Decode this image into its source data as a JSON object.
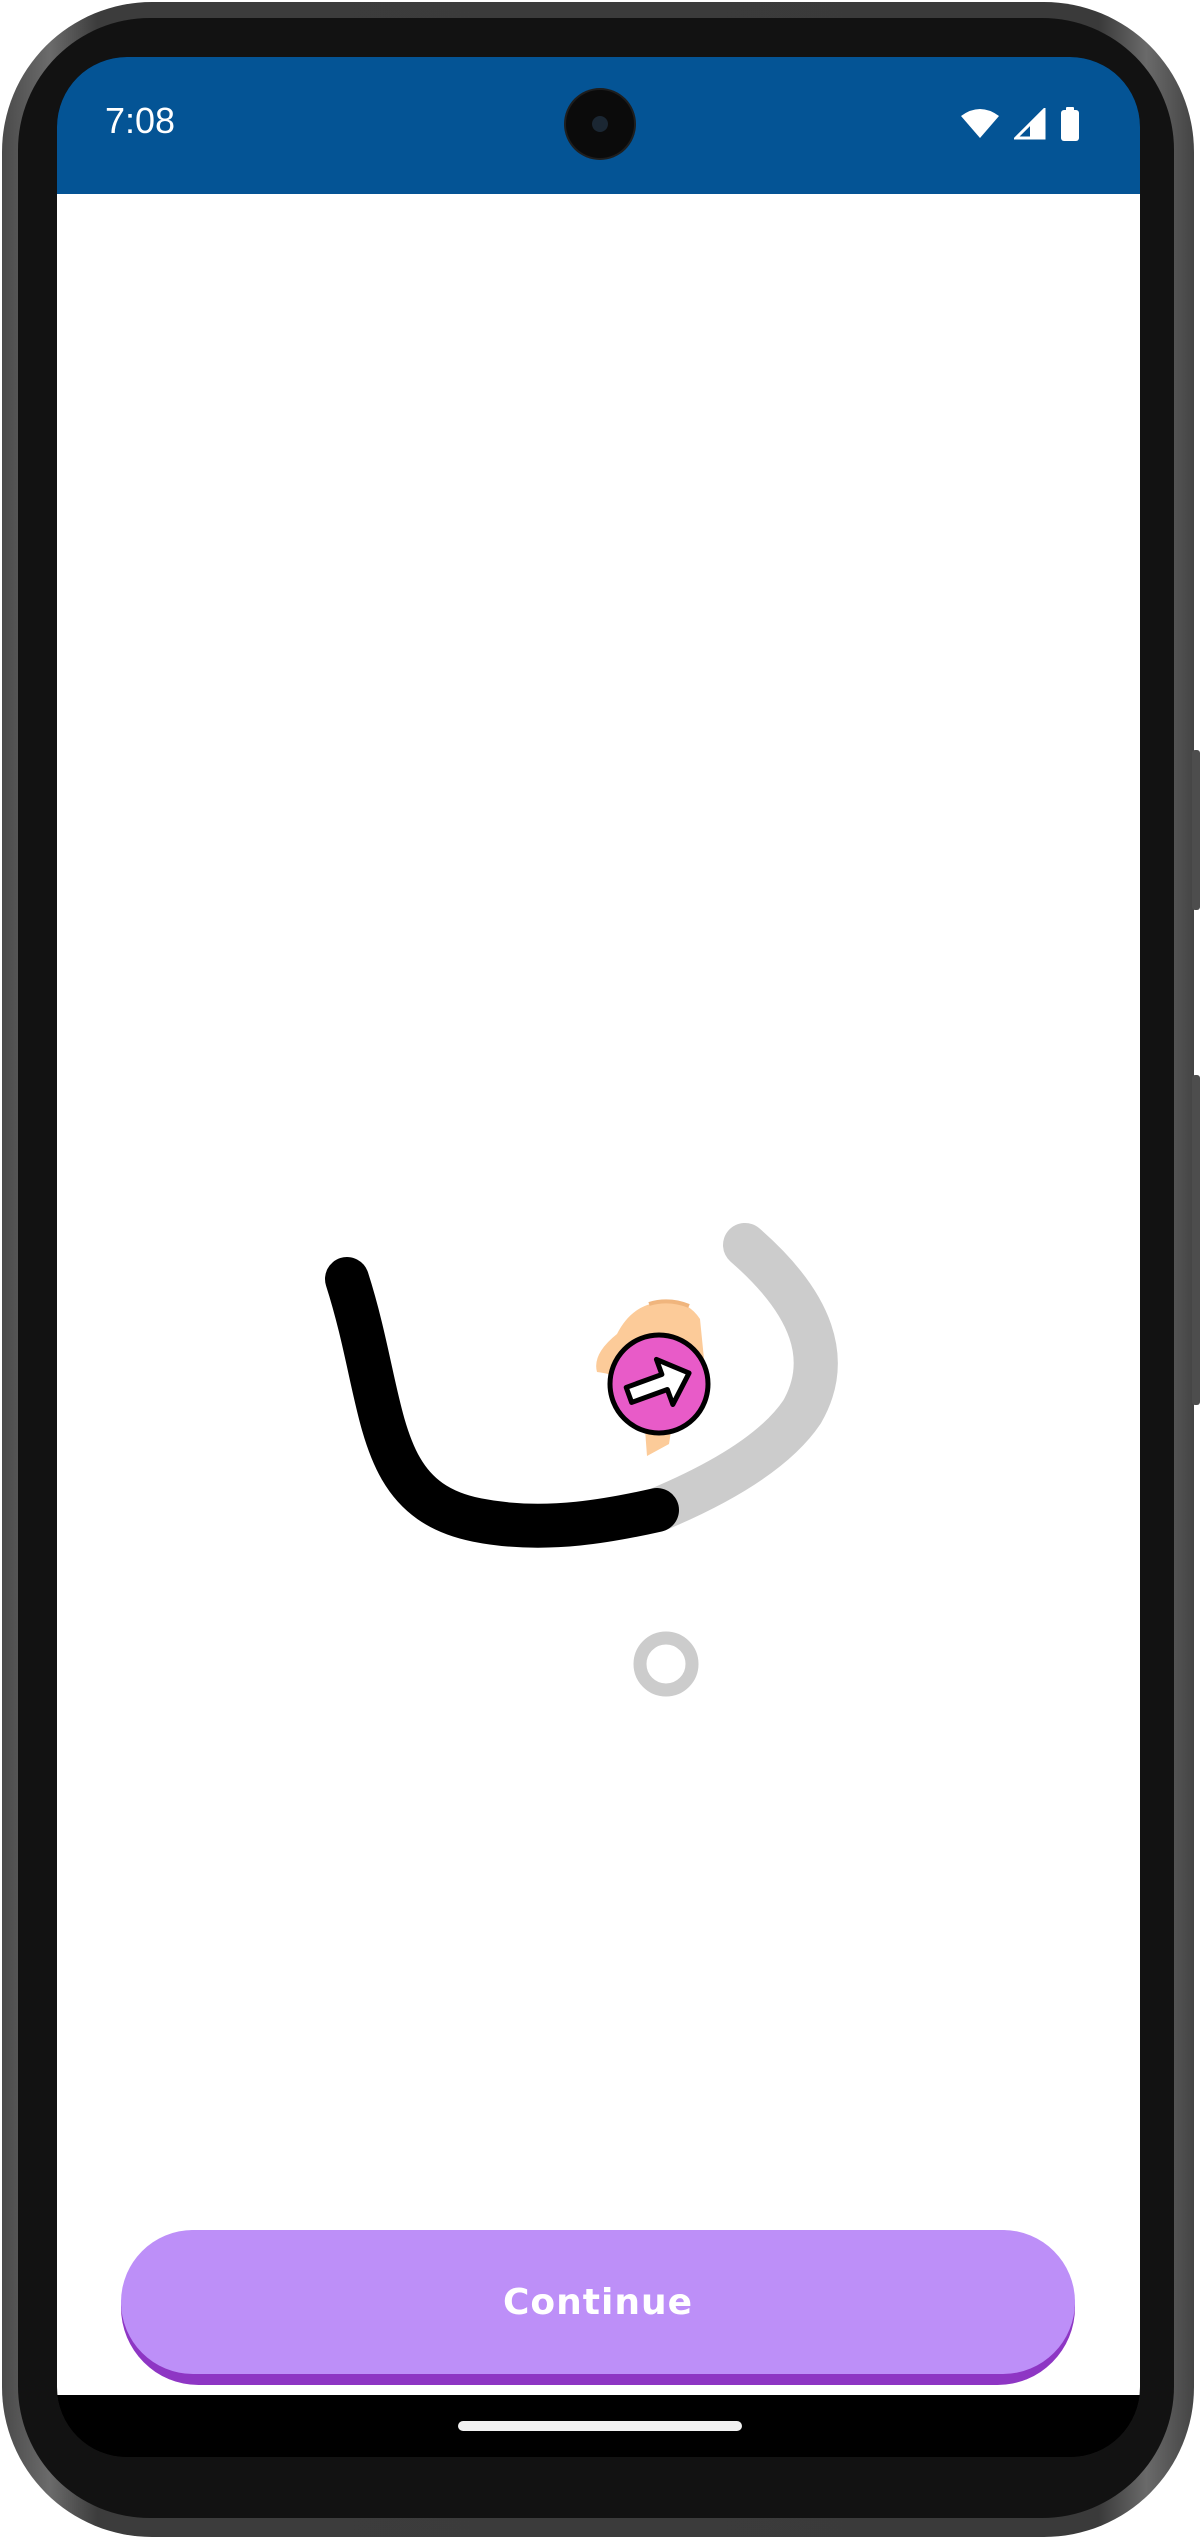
{
  "status_bar": {
    "time": "7:08",
    "icons": [
      "wifi-icon",
      "cellular-signal-icon",
      "battery-icon"
    ],
    "background_color": "#045495"
  },
  "tracing": {
    "completed_stroke_color": "#000000",
    "remaining_stroke_color": "#cccccc",
    "cursor_color": "#e85bc8",
    "cursor_icon": "arrow-right-icon",
    "hand_icon": "pointing-hand-icon",
    "dot_marker_color": "#cccccc"
  },
  "footer": {
    "continue_label": "Continue",
    "button_color": "#bd8ff8",
    "button_shadow_color": "#8e36c4"
  }
}
